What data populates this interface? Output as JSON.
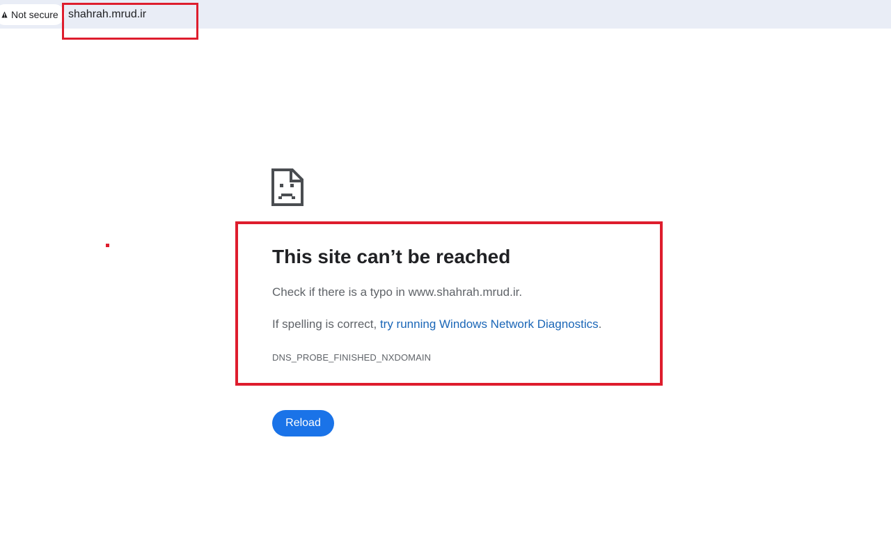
{
  "address_bar": {
    "security_label": "Not secure",
    "security_icon": "warning-triangle-icon",
    "url": "shahrah.mrud.ir"
  },
  "error_page": {
    "icon": "sad-page-icon",
    "title": "This site can’t be reached",
    "line_one": "Check if there is a typo in www.shahrah.mrud.ir.",
    "line_two_prefix": "If spelling is correct, ",
    "diagnostics_link": "try running Windows Network Diagnostics",
    "line_two_suffix": ".",
    "error_code": "DNS_PROBE_FINISHED_NXDOMAIN",
    "reload_label": "Reload"
  },
  "colors": {
    "annotation_red": "#de1d2d",
    "button_blue": "#1a73e8",
    "link_blue": "#1a66b7",
    "address_bar_bg": "#e9edf6"
  }
}
